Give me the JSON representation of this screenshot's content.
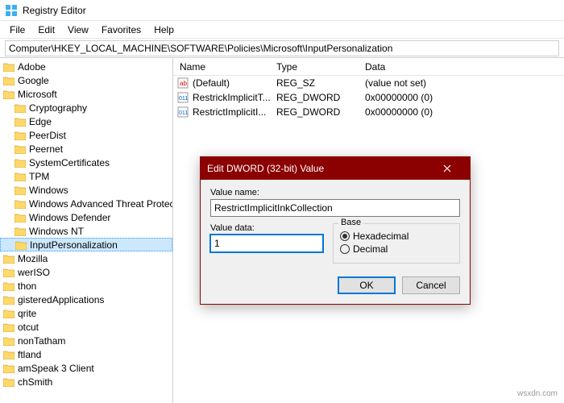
{
  "window": {
    "title": "Registry Editor"
  },
  "menu": {
    "file": "File",
    "edit": "Edit",
    "view": "View",
    "favorites": "Favorites",
    "help": "Help"
  },
  "address": {
    "path": "Computer\\HKEY_LOCAL_MACHINE\\SOFTWARE\\Policies\\Microsoft\\InputPersonalization"
  },
  "tree": {
    "items": [
      {
        "label": "Adobe",
        "lv": 0,
        "icon": "key"
      },
      {
        "label": "Google",
        "lv": 0,
        "icon": "key"
      },
      {
        "label": "Microsoft",
        "lv": 0,
        "icon": "key"
      },
      {
        "label": "Cryptography",
        "lv": 1,
        "icon": "folder"
      },
      {
        "label": "Edge",
        "lv": 1,
        "icon": "folder"
      },
      {
        "label": "PeerDist",
        "lv": 1,
        "icon": "folder"
      },
      {
        "label": "Peernet",
        "lv": 1,
        "icon": "folder"
      },
      {
        "label": "SystemCertificates",
        "lv": 1,
        "icon": "folder"
      },
      {
        "label": "TPM",
        "lv": 1,
        "icon": "folder"
      },
      {
        "label": "Windows",
        "lv": 1,
        "icon": "folder"
      },
      {
        "label": "Windows Advanced Threat Protect",
        "lv": 1,
        "icon": "folder"
      },
      {
        "label": "Windows Defender",
        "lv": 1,
        "icon": "folder"
      },
      {
        "label": "Windows NT",
        "lv": 1,
        "icon": "folder"
      },
      {
        "label": "InputPersonalization",
        "lv": 1,
        "icon": "folder",
        "selected": true
      },
      {
        "label": "Mozilla",
        "lv": 0,
        "icon": "key"
      },
      {
        "label": "werISO",
        "lv": 0,
        "icon": "key"
      },
      {
        "label": "thon",
        "lv": 0,
        "icon": "key"
      },
      {
        "label": "gisteredApplications",
        "lv": 0,
        "icon": "key"
      },
      {
        "label": "qrite",
        "lv": 0,
        "icon": "key"
      },
      {
        "label": "otcut",
        "lv": 0,
        "icon": "key"
      },
      {
        "label": "nonTatham",
        "lv": 0,
        "icon": "key"
      },
      {
        "label": "ftland",
        "lv": 0,
        "icon": "key"
      },
      {
        "label": "amSpeak 3 Client",
        "lv": 0,
        "icon": "key"
      },
      {
        "label": "chSmith",
        "lv": 0,
        "icon": "key"
      }
    ]
  },
  "cols": {
    "name": "Name",
    "type": "Type",
    "data": "Data"
  },
  "values": [
    {
      "icon": "str",
      "name": "(Default)",
      "type": "REG_SZ",
      "data": "(value not set)"
    },
    {
      "icon": "bin",
      "name": "RestrickImplicitT...",
      "type": "REG_DWORD",
      "data": "0x00000000 (0)"
    },
    {
      "icon": "bin",
      "name": "RestrictImplicitI...",
      "type": "REG_DWORD",
      "data": "0x00000000 (0)"
    }
  ],
  "dialog": {
    "title": "Edit DWORD (32-bit) Value",
    "valuename_label": "Value name:",
    "valuename": "RestrictImplicitInkCollection",
    "valuedata_label": "Value data:",
    "valuedata": "1",
    "base_label": "Base",
    "hex_label": "Hexadecimal",
    "dec_label": "Decimal",
    "ok": "OK",
    "cancel": "Cancel"
  },
  "watermark": "wsxdn.com"
}
